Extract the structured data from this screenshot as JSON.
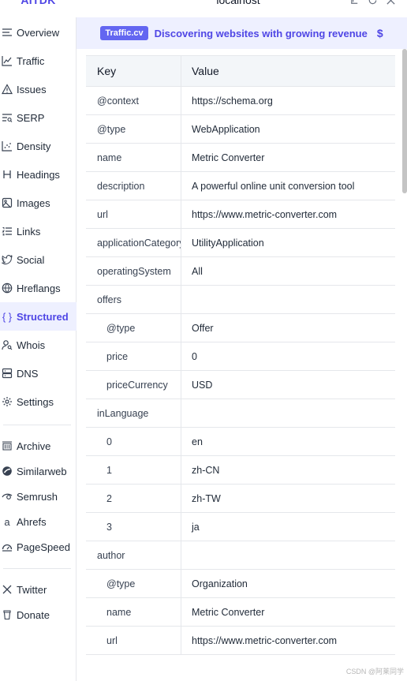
{
  "app": {
    "brand": "AITDK",
    "host": "localhost"
  },
  "sidebar": {
    "items": [
      {
        "label": "Overview",
        "icon": "list-icon",
        "active": false
      },
      {
        "label": "Traffic",
        "icon": "chart-line-icon",
        "active": false
      },
      {
        "label": "Issues",
        "icon": "warning-icon",
        "active": false
      },
      {
        "label": "SERP",
        "icon": "serp-icon",
        "active": false
      },
      {
        "label": "Density",
        "icon": "scatter-icon",
        "active": false
      },
      {
        "label": "Headings",
        "icon": "heading-icon",
        "active": false
      },
      {
        "label": "Images",
        "icon": "image-icon",
        "active": false
      },
      {
        "label": "Links",
        "icon": "list-ordered-icon",
        "active": false
      },
      {
        "label": "Social",
        "icon": "twitter-bird-icon",
        "active": false
      },
      {
        "label": "Hreflangs",
        "icon": "globe-icon",
        "active": false
      },
      {
        "label": "Structured",
        "icon": "braces-icon",
        "active": true
      },
      {
        "label": "Whois",
        "icon": "user-search-icon",
        "active": false
      },
      {
        "label": "DNS",
        "icon": "server-icon",
        "active": false
      },
      {
        "label": "Settings",
        "icon": "gear-icon",
        "active": false
      }
    ],
    "tools": [
      {
        "label": "Archive",
        "icon": "archive-icon"
      },
      {
        "label": "Similarweb",
        "icon": "similarweb-icon"
      },
      {
        "label": "Semrush",
        "icon": "semrush-icon"
      },
      {
        "label": "Ahrefs",
        "icon": "ahrefs-icon"
      },
      {
        "label": "PageSpeed",
        "icon": "speedometer-icon"
      }
    ],
    "social": [
      {
        "label": "Twitter",
        "icon": "x-logo-icon"
      },
      {
        "label": "Donate",
        "icon": "cup-icon"
      }
    ]
  },
  "banner": {
    "badge": "Traffic.cv",
    "text": "Discovering websites with growing revenue",
    "symbol": "$"
  },
  "table": {
    "headers": {
      "key": "Key",
      "value": "Value"
    },
    "rows": [
      {
        "key": "@context",
        "value": "https://schema.org",
        "nested": false
      },
      {
        "key": "@type",
        "value": "WebApplication",
        "nested": false
      },
      {
        "key": "name",
        "value": "Metric Converter",
        "nested": false
      },
      {
        "key": "description",
        "value": "A powerful online unit conversion tool",
        "nested": false
      },
      {
        "key": "url",
        "value": "https://www.metric-converter.com",
        "nested": false
      },
      {
        "key": "applicationCategory",
        "value": "UtilityApplication",
        "nested": false
      },
      {
        "key": "operatingSystem",
        "value": "All",
        "nested": false
      },
      {
        "key": "offers",
        "value": "",
        "nested": false
      },
      {
        "key": "@type",
        "value": "Offer",
        "nested": true
      },
      {
        "key": "price",
        "value": "0",
        "nested": true
      },
      {
        "key": "priceCurrency",
        "value": "USD",
        "nested": true
      },
      {
        "key": "inLanguage",
        "value": "",
        "nested": false
      },
      {
        "key": "0",
        "value": "en",
        "nested": true
      },
      {
        "key": "1",
        "value": "zh-CN",
        "nested": true
      },
      {
        "key": "2",
        "value": "zh-TW",
        "nested": true
      },
      {
        "key": "3",
        "value": "ja",
        "nested": true
      },
      {
        "key": "author",
        "value": "",
        "nested": false
      },
      {
        "key": "@type",
        "value": "Organization",
        "nested": true
      },
      {
        "key": "name",
        "value": "Metric Converter",
        "nested": true
      },
      {
        "key": "url",
        "value": "https://www.metric-converter.com",
        "nested": true
      }
    ]
  },
  "watermark": "CSDN @阿莱同学",
  "colors": {
    "accent": "#4f46e5",
    "banner_bg": "#eef0ff",
    "badge_bg": "#6366f1"
  }
}
